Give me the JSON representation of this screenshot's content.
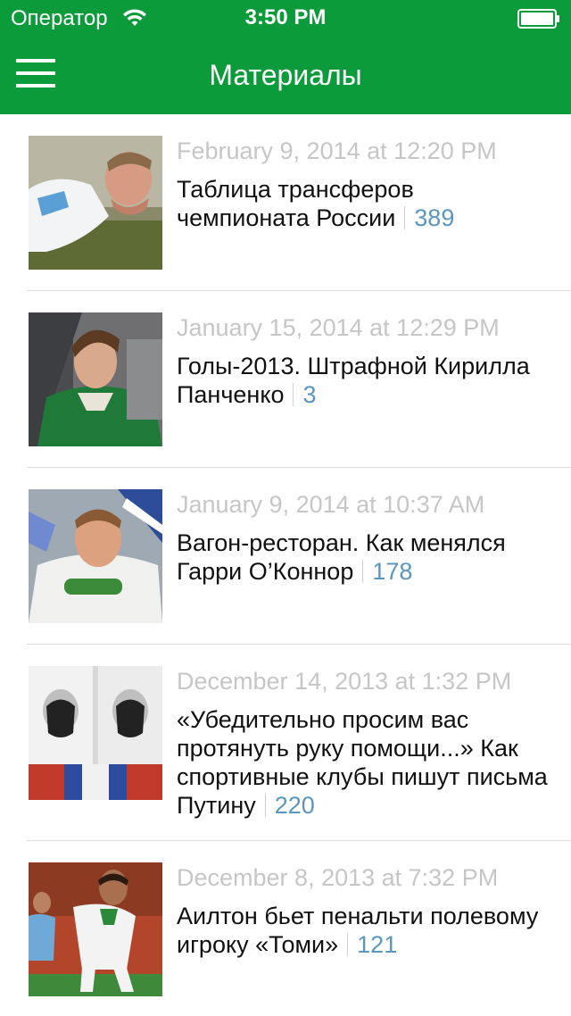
{
  "status_bar": {
    "carrier": "Оператор",
    "time": "3:50 PM"
  },
  "nav": {
    "title": "Материалы",
    "menu_icon": "hamburger-menu-icon"
  },
  "colors": {
    "header": "#0c9b3a",
    "date": "#c6c6c6",
    "count": "#5a96c0"
  },
  "articles": [
    {
      "date": "February 9, 2014 at 12:20 PM",
      "title": "Таблица трансферов чемпионата России",
      "count": "389",
      "thumb_desc": "player in white kit"
    },
    {
      "date": "January 15, 2014 at 12:29 PM",
      "title": "Голы-2013. Штрафной Кирилла Панченко",
      "count": "3",
      "thumb_desc": "player in green kit"
    },
    {
      "date": "January 9, 2014 at 10:37 AM",
      "title": "Вагон-ресторан. Как менялся Гарри О’Коннор",
      "count": "178",
      "thumb_desc": "player in white millions kit"
    },
    {
      "date": "December 14, 2013 at 1:32 PM",
      "title": "«Убедительно просим вас протянуть руку помощи...» Как спортивные клубы пишут письма Путину",
      "count": "220",
      "thumb_desc": "fans with t-shirts"
    },
    {
      "date": "December 8, 2013 at 7:32 PM",
      "title": "Аилтон бьет пенальти полевому игроку «Томи»",
      "count": "121",
      "thumb_desc": "players on pitch"
    }
  ]
}
